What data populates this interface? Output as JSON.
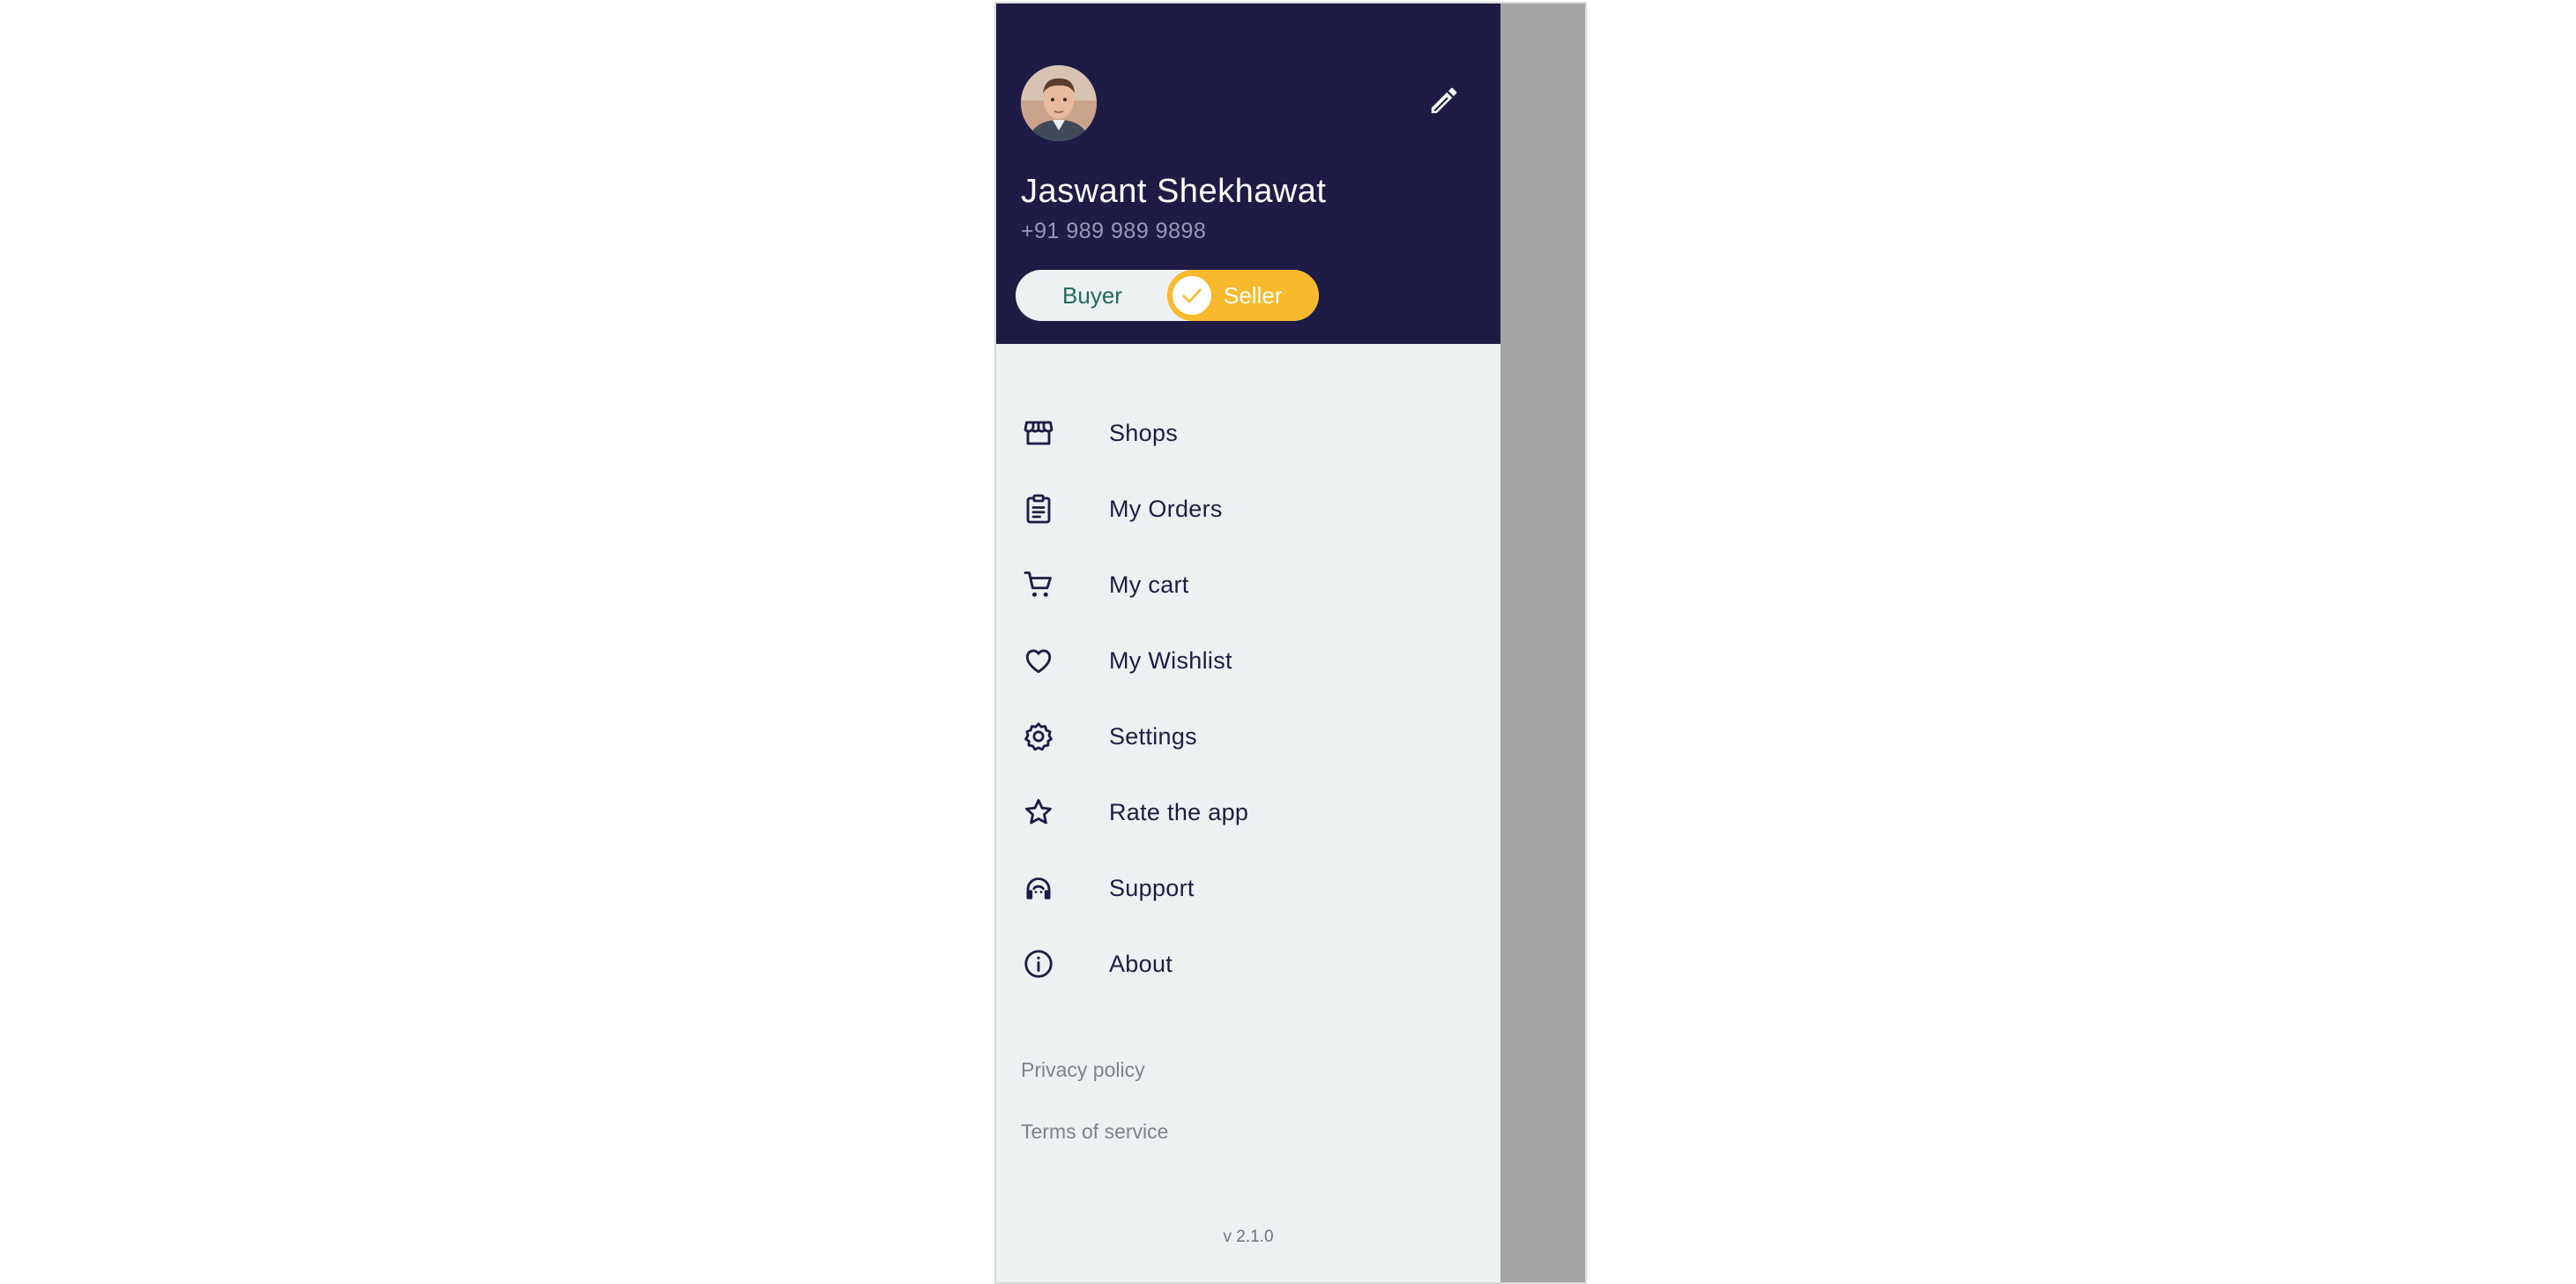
{
  "profile": {
    "name": "Jaswant Shekhawat",
    "phone": "+91 989 989 9898",
    "avatar_icon": "user-avatar-photo",
    "edit_icon": "pencil-icon"
  },
  "role_toggle": {
    "buyer_label": "Buyer",
    "seller_label": "Seller",
    "selected": "Seller",
    "accent_color": "#f8b92c"
  },
  "menu": {
    "items": [
      {
        "label": "Shops",
        "icon": "store-icon"
      },
      {
        "label": "My Orders",
        "icon": "clipboard-icon"
      },
      {
        "label": "My cart",
        "icon": "cart-icon"
      },
      {
        "label": "My Wishlist",
        "icon": "heart-icon"
      },
      {
        "label": "Settings",
        "icon": "gear-icon"
      },
      {
        "label": "Rate the app",
        "icon": "star-icon"
      },
      {
        "label": "Support",
        "icon": "headset-icon"
      },
      {
        "label": "About",
        "icon": "info-icon"
      }
    ]
  },
  "footer": {
    "privacy_label": "Privacy policy",
    "terms_label": "Terms of service",
    "version": "v 2.1.0"
  },
  "colors": {
    "header_bg": "#1e1c44",
    "drawer_bg": "#edf1f2",
    "scrim": "#a4a4a4",
    "text_primary": "#1e1c44"
  }
}
